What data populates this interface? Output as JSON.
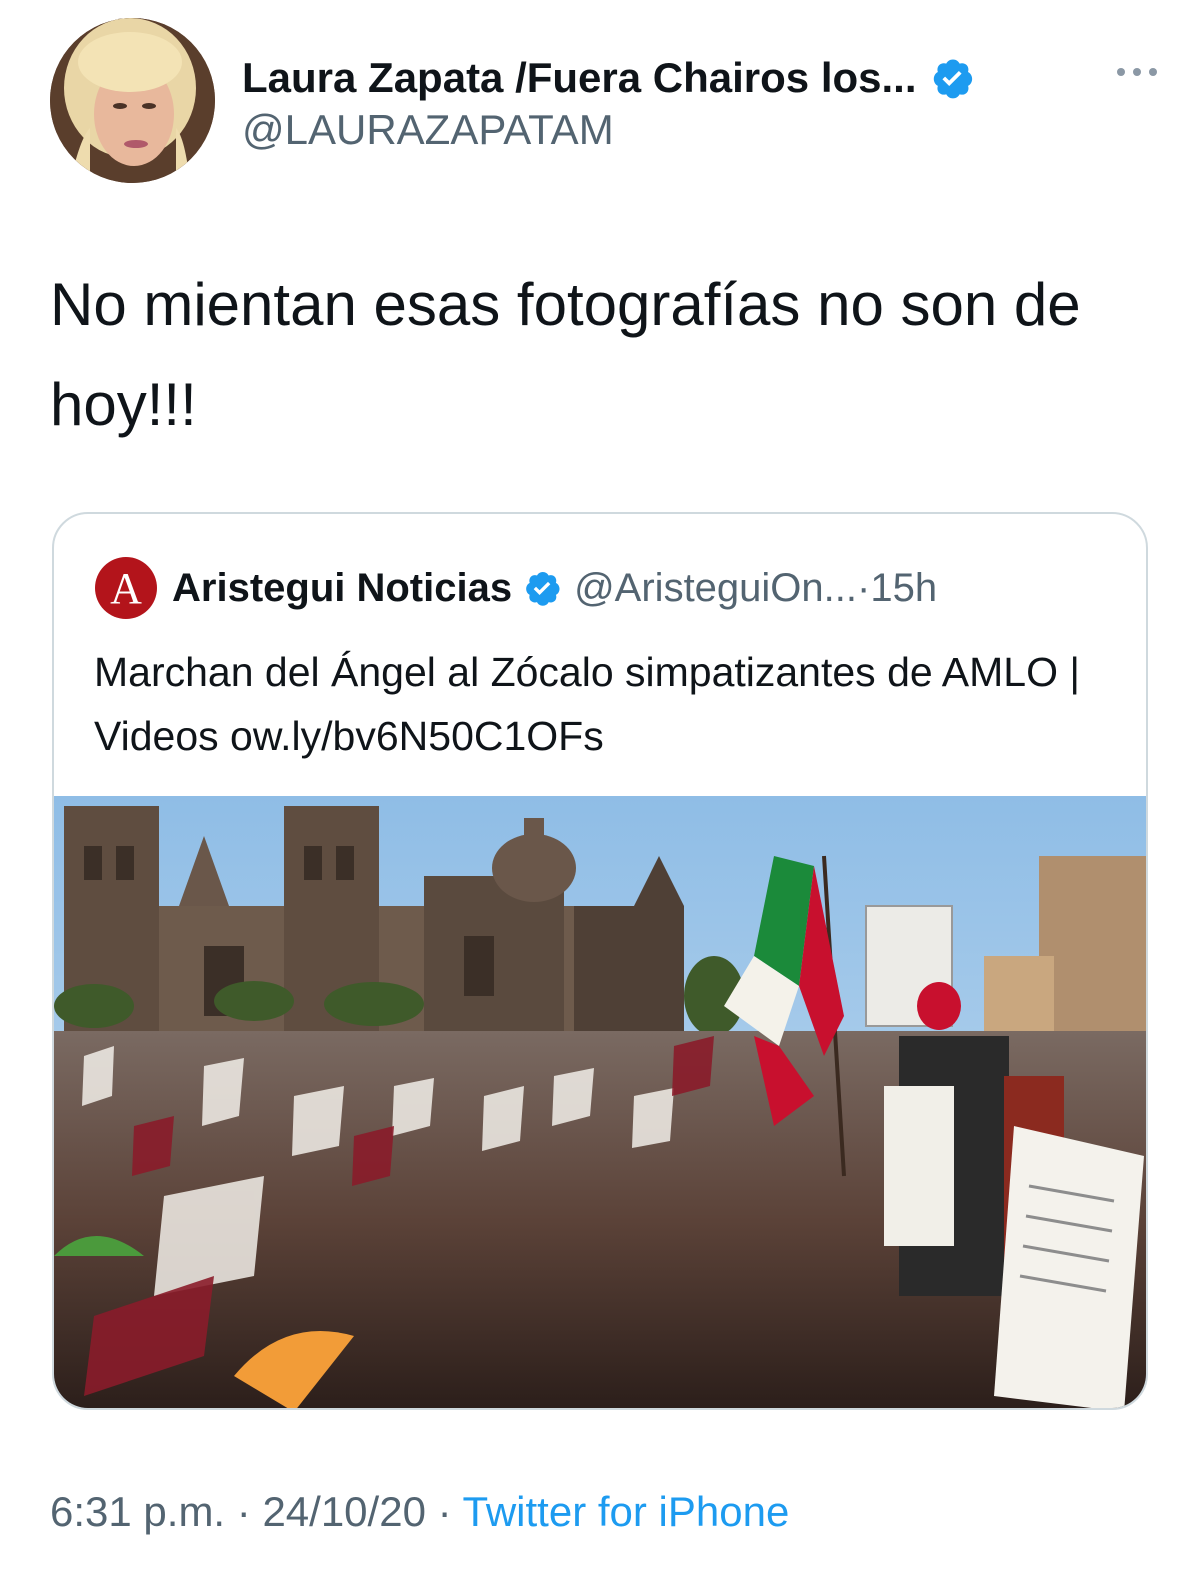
{
  "author": {
    "display_name": "Laura Zapata /Fuera Chairos los...",
    "handle": "@LAURAZAPATAM",
    "verified": true
  },
  "tweet": {
    "text": "No mientan esas fotografías no son de hoy!!!",
    "time": "6:31 p.m.",
    "date": "24/10/20",
    "source": "Twitter for iPhone",
    "separator": " · "
  },
  "quoted": {
    "display_name": "Aristegui Noticias",
    "handle": "@AristeguiOn...",
    "age": "15h",
    "separator": " · ",
    "logo_letter": "A",
    "text": "Marchan del Ángel al Zócalo simpatizantes de AMLO | Videos ow.ly/bv6N50C1OFs",
    "verified": true
  },
  "colors": {
    "verified_blue": "#1d9bf0",
    "aristegui_red": "#b3141b",
    "flag_green": "#1b8a3a",
    "flag_red": "#c8102e",
    "sky": "#9cc6ea",
    "cathedral": "#6e5b4c"
  }
}
